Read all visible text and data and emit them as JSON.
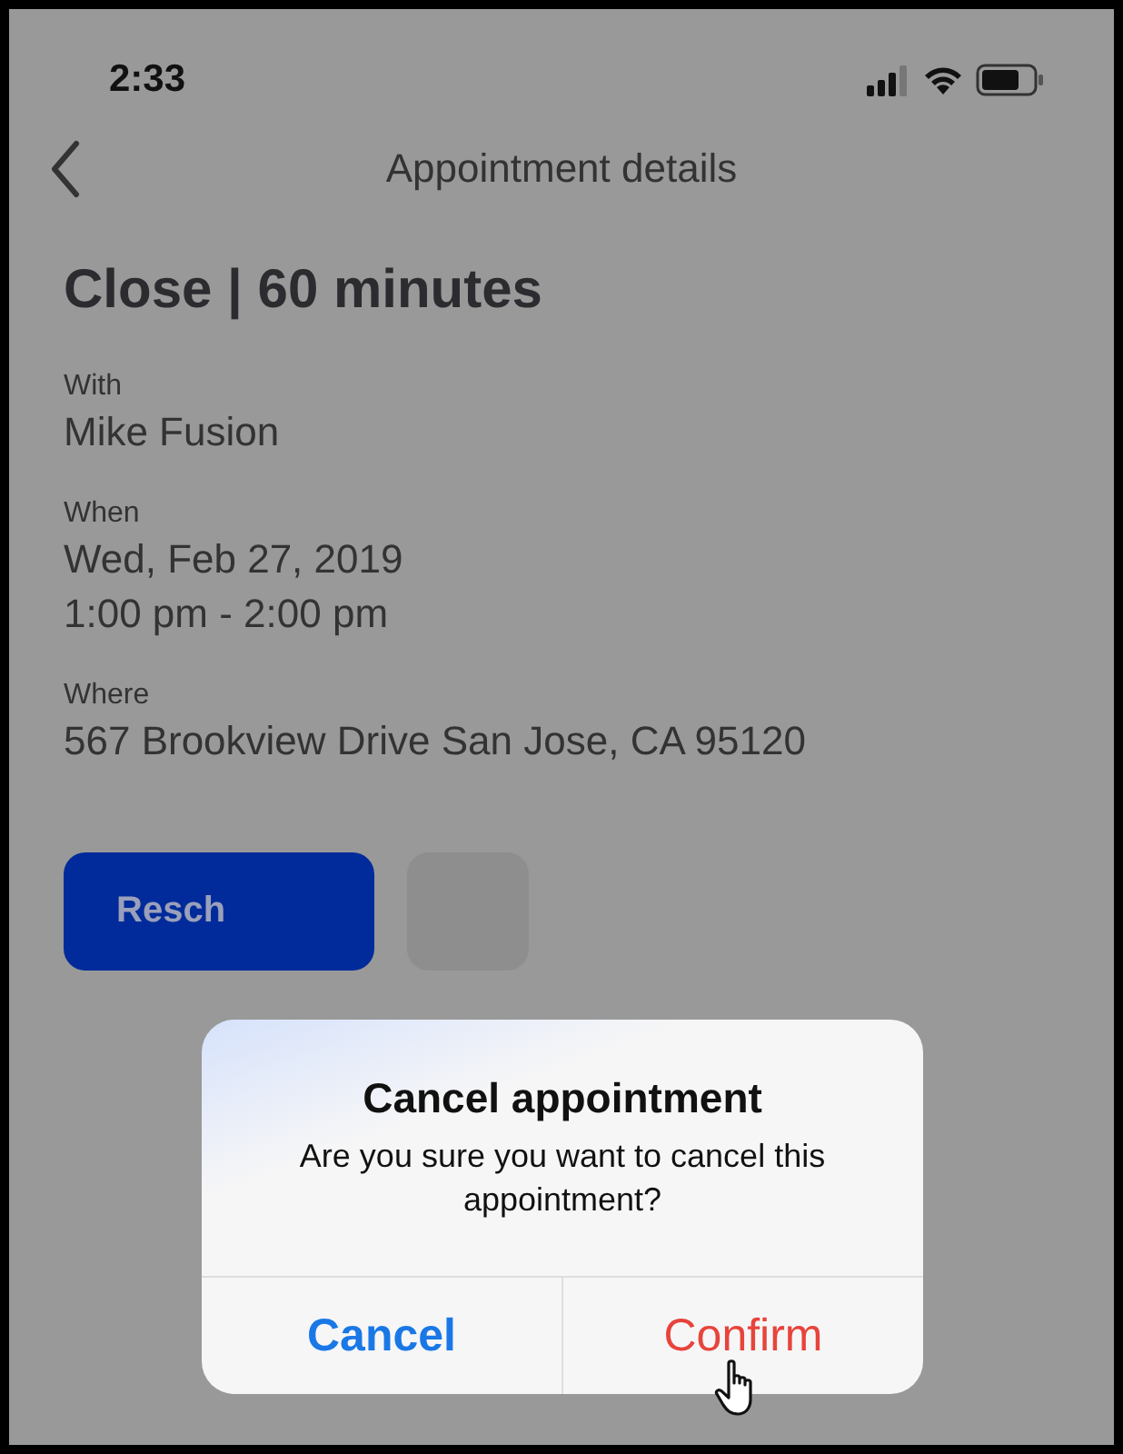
{
  "status_bar": {
    "time": "2:33"
  },
  "nav": {
    "title": "Appointment details"
  },
  "heading": "Close | 60 minutes",
  "details": [
    {
      "label": "With",
      "lines": [
        "Mike Fusion"
      ]
    },
    {
      "label": "When",
      "lines": [
        "Wed, Feb 27, 2019",
        "1:00 pm - 2:00 pm"
      ]
    },
    {
      "label": "Where",
      "lines": [
        "567 Brookview Drive San Jose, CA 95120"
      ]
    }
  ],
  "actions": [
    {
      "kind": "primary",
      "label": "Resch"
    },
    {
      "kind": "secondary"
    }
  ],
  "dialog": {
    "title": "Cancel appointment",
    "message": "Are you sure you want to cancel this appointment?",
    "buttons": [
      {
        "label": "Cancel",
        "kind": "default"
      },
      {
        "label": "Confirm",
        "kind": "destructive"
      }
    ]
  }
}
